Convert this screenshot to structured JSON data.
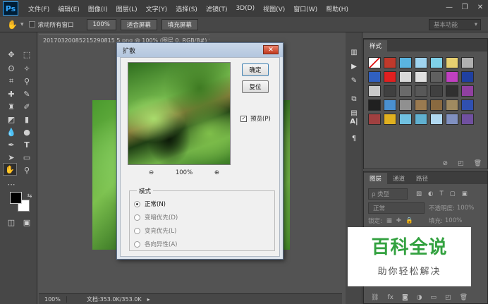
{
  "menubar": {
    "logo": "Ps",
    "items": [
      "文件(F)",
      "编辑(E)",
      "图像(I)",
      "图层(L)",
      "文字(Y)",
      "选择(S)",
      "滤镜(T)",
      "3D(D)",
      "视图(V)",
      "窗口(W)",
      "帮助(H)"
    ],
    "window_controls": [
      "—",
      "❐",
      "✕"
    ]
  },
  "options_bar": {
    "scroll_all_windows": "滚动所有窗口",
    "zoom_value": "100%",
    "fit_screen": "适合屏幕",
    "fill_screen": "填充屏幕",
    "workspace": "基本功能"
  },
  "document": {
    "tab_title": "20170320085215290815 5.png @ 100% (图层 0, RGB/8#) *",
    "status_zoom": "100%",
    "status_doc": "文档:353.0K/353.0K"
  },
  "dialog": {
    "title": "扩散",
    "ok_label": "确定",
    "reset_label": "复位",
    "preview_label": "预览(P)",
    "preview_checked": true,
    "zoom_value": "100%",
    "mode_legend": "模式",
    "modes": [
      "正常(N)",
      "变暗优先(D)",
      "变亮优先(L)",
      "各向异性(A)"
    ],
    "selected_mode": "正常(N)"
  },
  "styles_panel": {
    "tab": "样式",
    "swatch_colors": [
      "#ffffff",
      "#c0392b",
      "#5ab4e0",
      "#9fd4f0",
      "#7fd0e8",
      "#e8d070",
      "#b0b0b0",
      "#3060c0",
      "#e02020",
      "#d8d8d8",
      "#e0e0e0",
      "#606060",
      "#c040c0",
      "#2040a0",
      "#c8c8c8",
      "#404040",
      "#6a6a6a",
      "#585858",
      "#404040",
      "#303030",
      "#9040a0",
      "#202020",
      "#4a90d0",
      "#909090",
      "#9a7a50",
      "#8a6a40",
      "#a08a60",
      "#3050b0",
      "#a04040",
      "#e0b020",
      "#70c0e0",
      "#60b0d0",
      "#b0d8f0",
      "#8090c0",
      "#7050a0"
    ]
  },
  "layers_panel": {
    "tabs": [
      "图层",
      "通道",
      "路径"
    ],
    "filter_label": "ρ 类型",
    "blend_mode": "正常",
    "opacity_label": "不透明度:",
    "opacity_value": "100%",
    "lock_label": "锁定:",
    "fill_label": "填充:",
    "fill_value": "100%"
  },
  "watermark": {
    "title": "百科全说",
    "subtitle": "助你轻松解决"
  }
}
